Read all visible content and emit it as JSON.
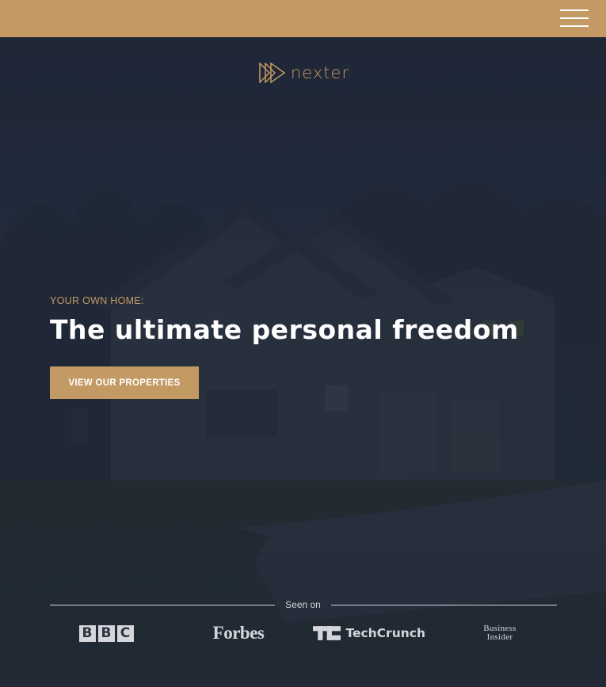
{
  "header": {
    "menu_icon": "hamburger-menu-icon",
    "background_color": "#c49a64"
  },
  "brand": {
    "name": "nexter",
    "logo_icon": "triple-play-triangle-icon",
    "accent_color": "#c49a64"
  },
  "hero": {
    "eyebrow": "YOUR OWN HOME:",
    "headline": "The ultimate personal freedom",
    "cta_label": "VIEW OUR PROPERTIES",
    "background_image": "house-at-dusk"
  },
  "seen_on": {
    "label": "Seen on",
    "logos": [
      {
        "name": "BBC",
        "letters": [
          "B",
          "B",
          "C"
        ]
      },
      {
        "name": "Forbes",
        "text": "Forbes"
      },
      {
        "name": "TechCrunch",
        "mark": "TC",
        "text": "TechCrunch"
      },
      {
        "name": "Business Insider",
        "line1": "Business",
        "line2": "Insider"
      }
    ]
  }
}
